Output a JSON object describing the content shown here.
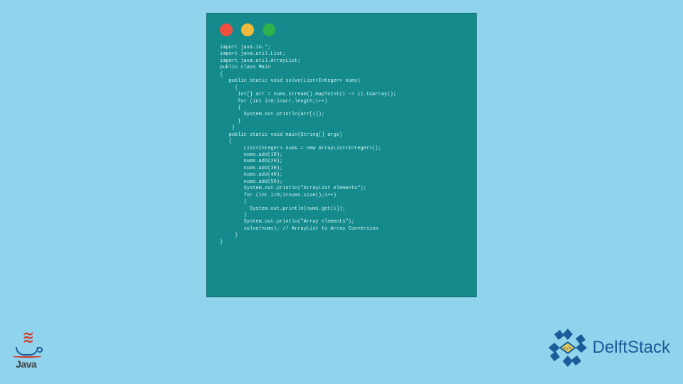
{
  "code": {
    "lines": [
      "import java.io.*;",
      "import java.util.List;",
      "import java.util.ArrayList;",
      "public class Main",
      "{",
      "   public static void solve(List<Integer> nums)",
      "     {",
      "      int[] arr = nums.stream().mapToInt(i -> i).toArray();",
      "      for (int i=0;i<arr.length;i++)",
      "      {",
      "        System.out.println(arr[i]);",
      "      }",
      "    }",
      "   public static void main(String[] args)",
      "   {",
      "        List<Integer> nums = new ArrayList<Integer>();",
      "        nums.add(10);",
      "        nums.add(20);",
      "        nums.add(30);",
      "        nums.add(40);",
      "        nums.add(50);",
      "        System.out.println(\"ArrayList elements\");",
      "        for (int i=0;i<nums.size();i++)",
      "        {",
      "          System.out.println(nums.get(i));",
      "        }",
      "        System.out.println(\"Array elements\");",
      "        solve(nums); // ArrayList to Array Conversion",
      "     }",
      "}"
    ]
  },
  "logos": {
    "java_text": "Java",
    "delft_text": "DelftStack"
  },
  "controls": {
    "red": "close",
    "yellow": "minimize",
    "green": "maximize"
  }
}
